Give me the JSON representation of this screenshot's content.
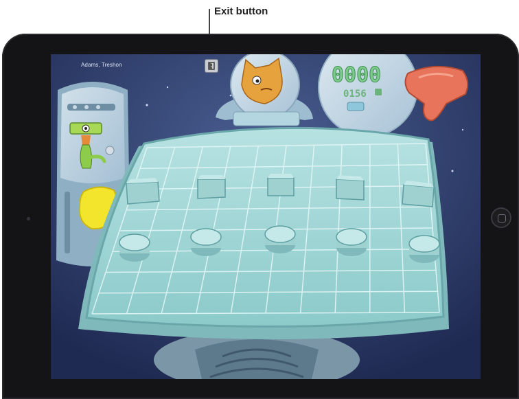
{
  "annotation": {
    "label": "Exit button"
  },
  "hud": {
    "player_name": "Adams, Treshon",
    "score_digits": "0000",
    "sub_counter": "0156"
  },
  "colors": {
    "tablet_bezel": "#141416",
    "space_background": "#2c3b6b",
    "game_board": "#a9d8d8",
    "board_grid": "#e4f6f6",
    "score_green": "#7ccb8a",
    "yellow_sponge": "#f2e52c",
    "red_tool": "#e8745c",
    "orange_cat": "#e6a23c"
  },
  "icons": {
    "exit": "exit-door-icon"
  }
}
